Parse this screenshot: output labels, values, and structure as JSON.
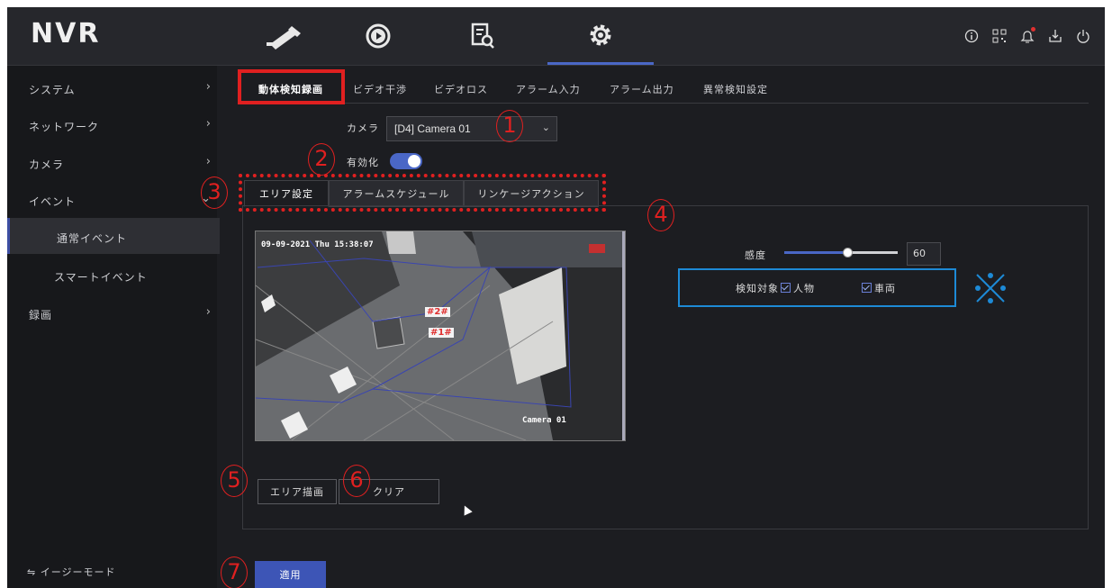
{
  "app": {
    "logo": "NVR"
  },
  "nav": {
    "tabs": [
      {
        "name": "live-view",
        "icon": "camera-icon"
      },
      {
        "name": "playback",
        "icon": "playback-icon"
      },
      {
        "name": "search",
        "icon": "file-search-icon"
      },
      {
        "name": "settings",
        "icon": "gear-icon",
        "active": true
      }
    ],
    "status_icons": [
      "info-icon",
      "qr-code-icon",
      "notification-bell-icon",
      "download-icon",
      "power-icon"
    ]
  },
  "sidebar": {
    "items": [
      {
        "label": "システム",
        "chevron": "›"
      },
      {
        "label": "ネットワーク",
        "chevron": "›"
      },
      {
        "label": "カメラ",
        "chevron": "›"
      },
      {
        "label": "イベント",
        "chevron": "⌄"
      },
      {
        "label": "通常イベント",
        "chevron": ""
      },
      {
        "label": "スマートイベント",
        "chevron": ""
      },
      {
        "label": "録画",
        "chevron": "›"
      }
    ],
    "easy_mode": "⇋ イージーモード"
  },
  "tabs": [
    {
      "label": "動体検知録画"
    },
    {
      "label": "ビデオ干渉"
    },
    {
      "label": "ビデオロス"
    },
    {
      "label": "アラーム入力"
    },
    {
      "label": "アラーム出力"
    },
    {
      "label": "異常検知設定"
    }
  ],
  "camera": {
    "label": "カメラ",
    "value": "[D4] Camera 01"
  },
  "enable": {
    "label": "有効化",
    "on": true
  },
  "subtabs": [
    {
      "label": "エリア設定"
    },
    {
      "label": "アラームスケジュール"
    },
    {
      "label": "リンケージアクション"
    }
  ],
  "video": {
    "timestamp": "09-09-2021 Thu 15:38:07",
    "camera_name": "Camera 01",
    "zones": [
      "#2#",
      "#1#"
    ]
  },
  "sensitivity": {
    "label": "感度",
    "value": "60",
    "level": 0.6
  },
  "detect_target": {
    "label": "検知対象",
    "human": "人物",
    "vehicle": "車両"
  },
  "buttons": {
    "draw_area": "エリア描画",
    "clear": "クリア",
    "apply": "適用"
  },
  "annotations": {
    "numbers": [
      "1",
      "2",
      "3",
      "4",
      "5",
      "6",
      "7"
    ]
  },
  "colors": {
    "accent": "#4a67c6",
    "annotation_red": "#e02020",
    "annotation_blue": "#1d8ad6"
  }
}
